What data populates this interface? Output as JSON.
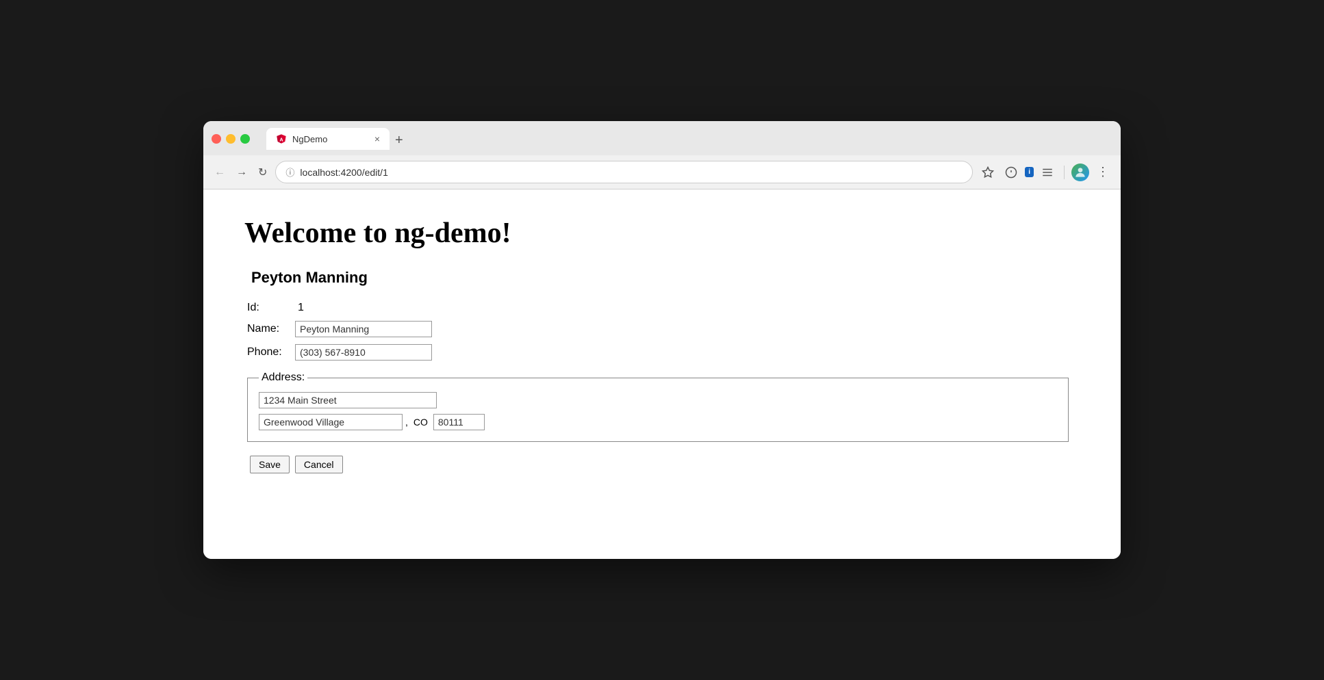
{
  "browser": {
    "tab_title": "NgDemo",
    "url": "localhost:4200/edit/1",
    "close_tab_label": "×",
    "new_tab_label": "+"
  },
  "nav": {
    "back_label": "←",
    "forward_label": "→",
    "reload_label": "↻",
    "info_icon_label": "ⓘ"
  },
  "page": {
    "title": "Welcome to ng-demo!",
    "person_name": "Peyton Manning",
    "id_label": "Id:",
    "id_value": "1",
    "name_label": "Name:",
    "name_value": "Peyton Manning",
    "phone_label": "Phone:",
    "phone_value": "(303) 567-8910",
    "address_legend": "Address:",
    "street_value": "1234 Main Street",
    "city_value": "Greenwood Village",
    "city_state_separator": ",",
    "state_value": "CO",
    "zip_value": "80111",
    "save_label": "Save",
    "cancel_label": "Cancel"
  },
  "angular_icon_letter": "A",
  "extension_badge": "i",
  "toolbar_extension_label": "i"
}
